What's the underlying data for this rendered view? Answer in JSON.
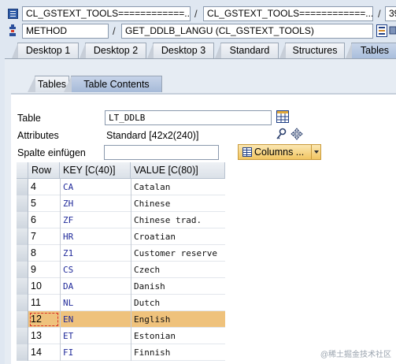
{
  "top_bar": {
    "row1": {
      "field1": "CL_GSTEXT_TOOLS============...",
      "sep": "/",
      "field2": "CL_GSTEXT_TOOLS============...",
      "field3": "39"
    },
    "row2": {
      "type": "METHOD",
      "sep": "/",
      "method": "GET_DDLB_LANGU (CL_GSTEXT_TOOLS)"
    }
  },
  "desktop_tabs": [
    "Desktop 1",
    "Desktop 2",
    "Desktop 3",
    "Standard",
    "Structures",
    "Tables"
  ],
  "active_desktop_tab": "Tables",
  "sub_tabs": [
    "Tables",
    "Table Contents"
  ],
  "active_sub_tab": "Table Contents",
  "form": {
    "table_label": "Table",
    "table_value": "LT_DDLB",
    "attributes_label": "Attributes",
    "attributes_value": "Standard [42x2(240)]",
    "spalte_label": "Spalte einfügen",
    "spalte_value": "",
    "columns_button": "Columns ..."
  },
  "grid": {
    "headers": [
      "Row",
      "KEY [C(40)]",
      "VALUE [C(80)]"
    ],
    "rows": [
      {
        "row": "4",
        "key": "CA",
        "value": "Catalan"
      },
      {
        "row": "5",
        "key": "ZH",
        "value": "Chinese"
      },
      {
        "row": "6",
        "key": "ZF",
        "value": "Chinese trad."
      },
      {
        "row": "7",
        "key": "HR",
        "value": "Croatian"
      },
      {
        "row": "8",
        "key": "Z1",
        "value": "Customer reserve"
      },
      {
        "row": "9",
        "key": "CS",
        "value": "Czech"
      },
      {
        "row": "10",
        "key": "DA",
        "value": "Danish"
      },
      {
        "row": "11",
        "key": "NL",
        "value": "Dutch"
      },
      {
        "row": "12",
        "key": "EN",
        "value": "English"
      },
      {
        "row": "13",
        "key": "ET",
        "value": "Estonian"
      },
      {
        "row": "14",
        "key": "FI",
        "value": "Finnish"
      }
    ],
    "selected_row": "12"
  },
  "watermark": "@稀土掘金技术社区",
  "colors": {
    "selected_row": "#efc27c",
    "active_tab": "#a9bedc",
    "key_text": "#202a9a"
  }
}
